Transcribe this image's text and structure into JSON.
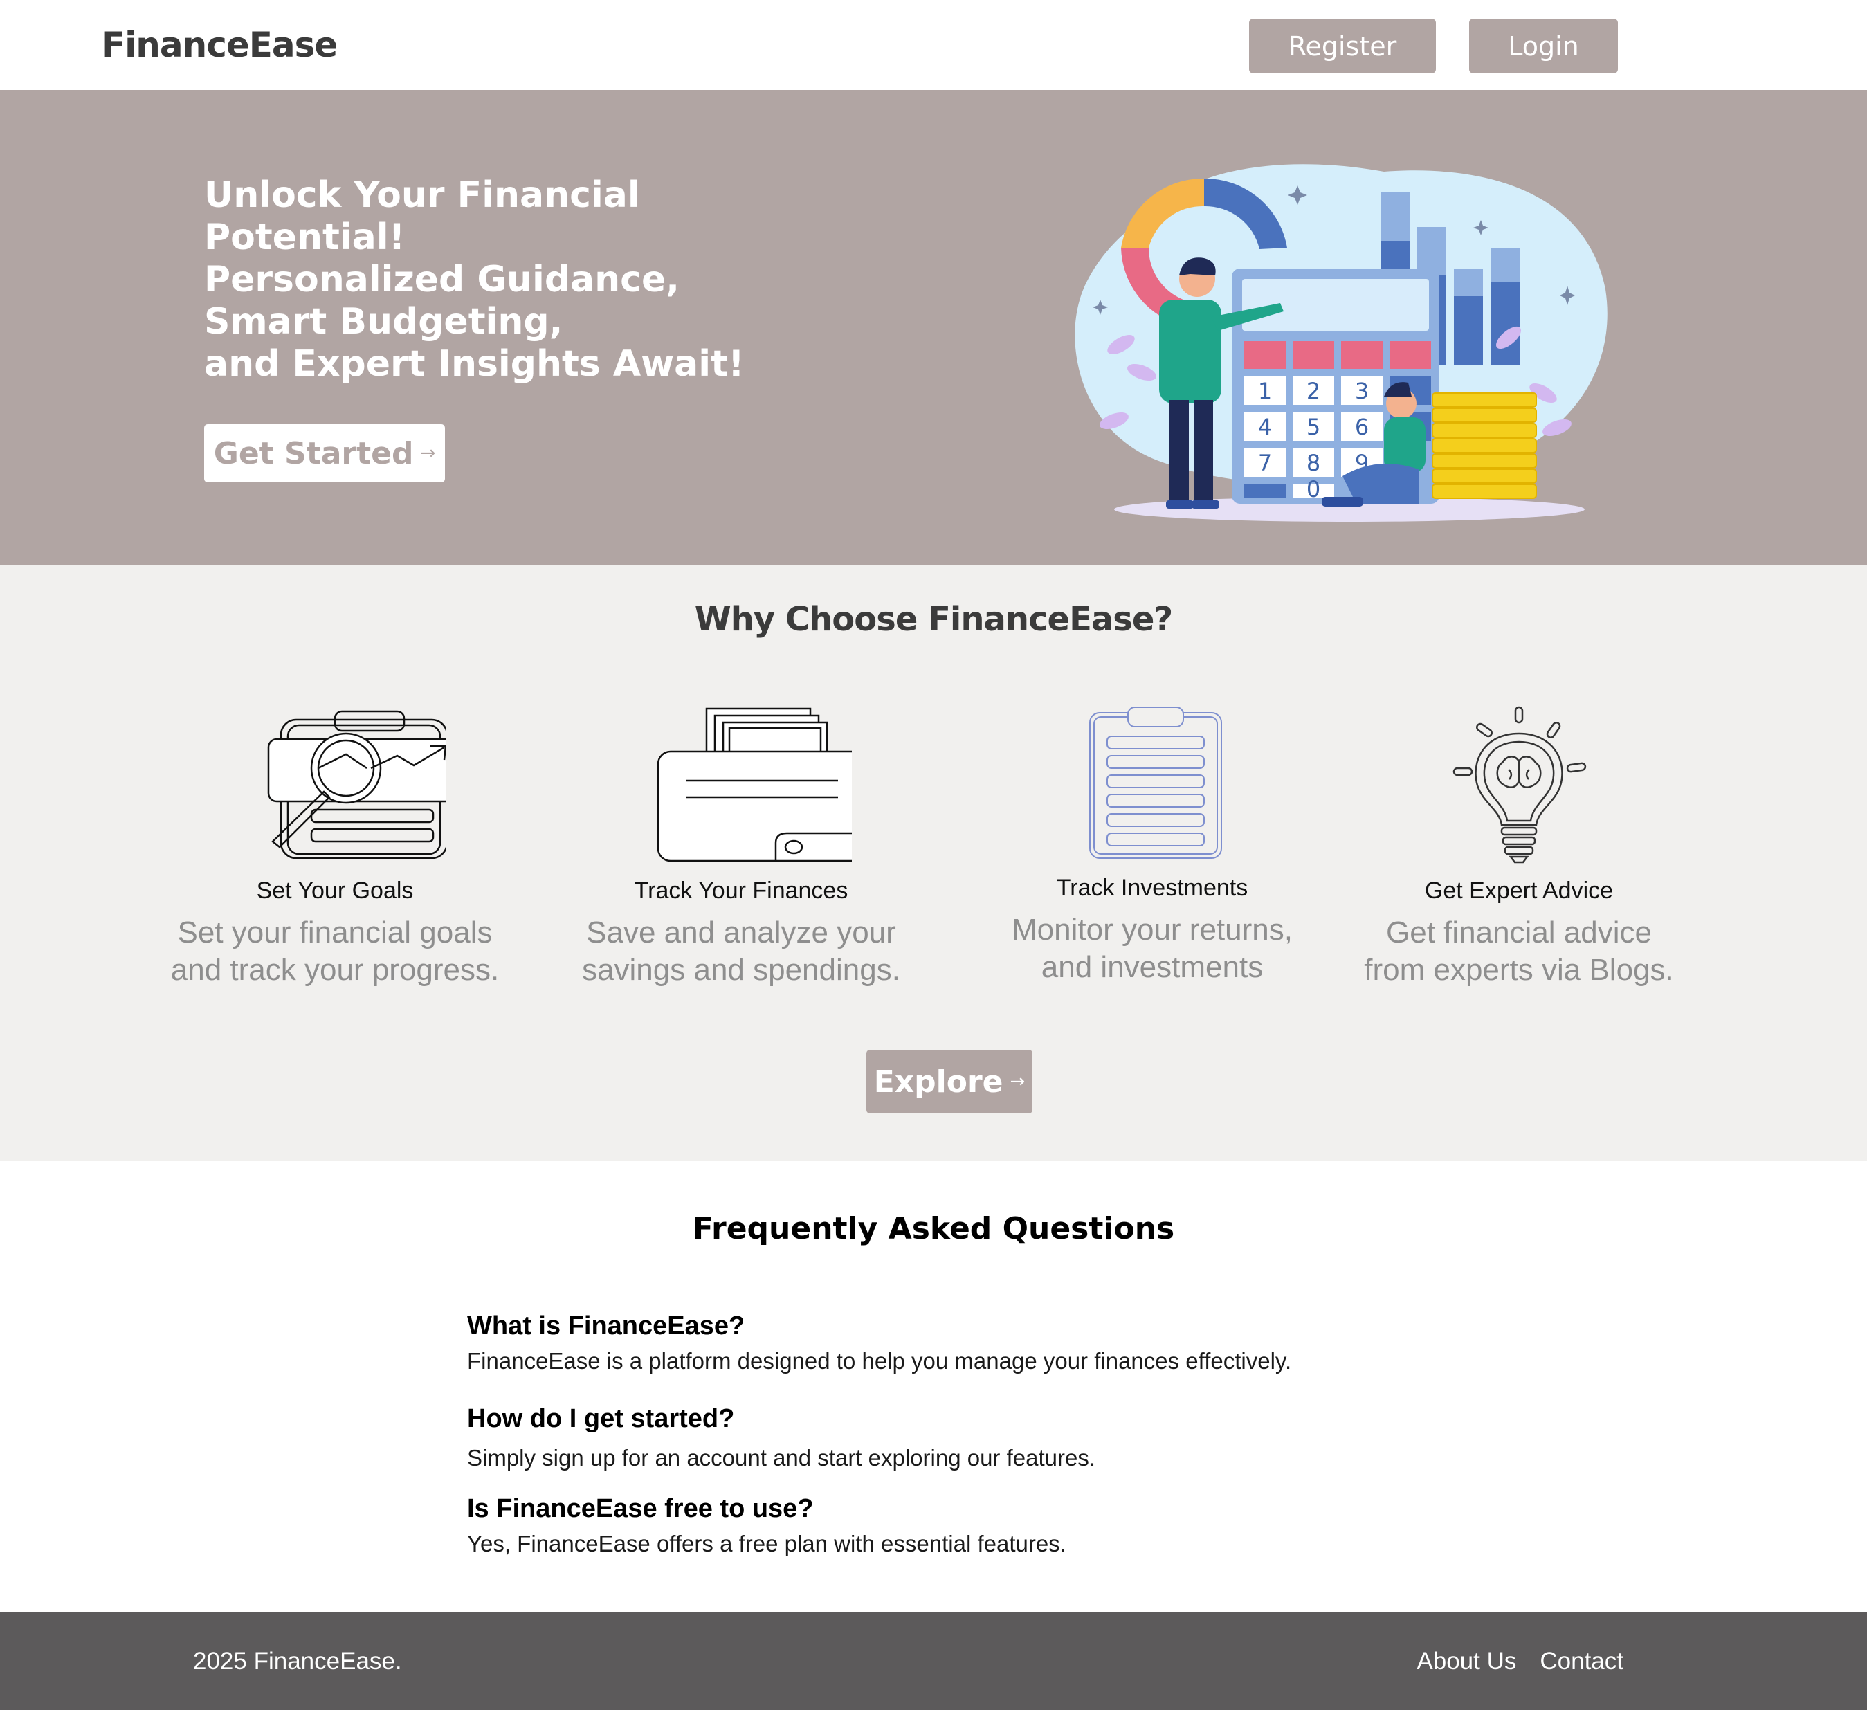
{
  "nav": {
    "brand": "FinanceEase",
    "register_label": "Register",
    "login_label": "Login"
  },
  "hero": {
    "title_lines": [
      "Unlock Your Financial",
      "Potential!",
      "Personalized Guidance,",
      "Smart Budgeting,",
      "and Expert Insights Await!"
    ],
    "cta_label": "Get Started",
    "cta_arrow": "→",
    "calculator_keys": [
      "1",
      "2",
      "3",
      "4",
      "5",
      "6",
      "7",
      "8",
      "9",
      "0"
    ]
  },
  "why": {
    "title": "Why Choose FinanceEase?",
    "features": [
      {
        "title": "Set Your Goals",
        "desc_lines": [
          "Set your financial goals",
          "and track your progress."
        ],
        "icon": "goals-magnifier-chart-icon"
      },
      {
        "title": "Track Your Finances",
        "desc_lines": [
          "Save and analyze your",
          "savings and spendings."
        ],
        "icon": "wallet-icon"
      },
      {
        "title": "Track Investments",
        "desc_lines": [
          "Monitor your returns,",
          "and investments"
        ],
        "icon": "clipboard-icon"
      },
      {
        "title": "Get Expert Advice",
        "desc_lines": [
          "Get financial advice",
          "from experts via Blogs."
        ],
        "icon": "lightbulb-brain-icon"
      }
    ],
    "explore_label": "Explore",
    "explore_arrow": "→"
  },
  "faq": {
    "title": "Frequently Asked Questions",
    "items": [
      {
        "q": "What is FinanceEase?",
        "a": "FinanceEase is a platform designed to help you manage your finances effectively."
      },
      {
        "q": "How do I get started?",
        "a": "Simply sign up for an account and start exploring our features."
      },
      {
        "q": "Is FinanceEase free to use?",
        "a": "Yes, FinanceEase offers a free plan with essential features."
      }
    ]
  },
  "footer": {
    "copyright": "2025 FinanceEase.",
    "links": [
      "About Us",
      "Contact"
    ]
  },
  "colors": {
    "accent": "#b1a5a3",
    "section_bg": "#f1f0ee",
    "footer_bg": "#5c5a5b"
  }
}
